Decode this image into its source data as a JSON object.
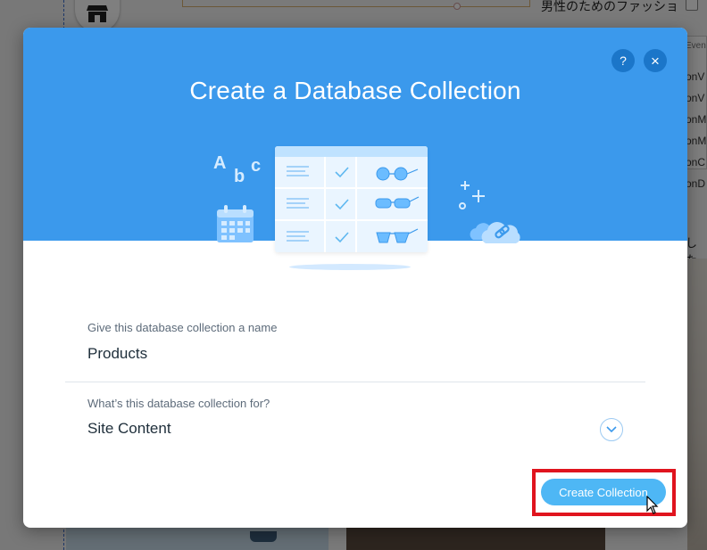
{
  "background": {
    "header_text": "男性のためのファッショ",
    "panel_heading": "Even",
    "panel_rows": [
      "onV",
      "onV",
      "onM",
      "onM",
      "onC",
      "onD"
    ],
    "side_text": "した"
  },
  "modal": {
    "title": "Create a Database Collection",
    "help_label": "?",
    "close_label": "×",
    "illustration_letters": [
      "A",
      "b",
      "c"
    ],
    "name_field": {
      "label": "Give this database collection a name",
      "value": "Products"
    },
    "purpose_field": {
      "label": "What’s this database collection for?",
      "value": "Site Content"
    },
    "create_button": "Create Collection"
  },
  "colors": {
    "header_blue": "#3b99ec",
    "button_blue": "#4eb7f5",
    "highlight_red": "#e0141e"
  },
  "icons": [
    "store-icon",
    "help-icon",
    "close-icon",
    "chevron-down-icon",
    "cursor-icon"
  ]
}
